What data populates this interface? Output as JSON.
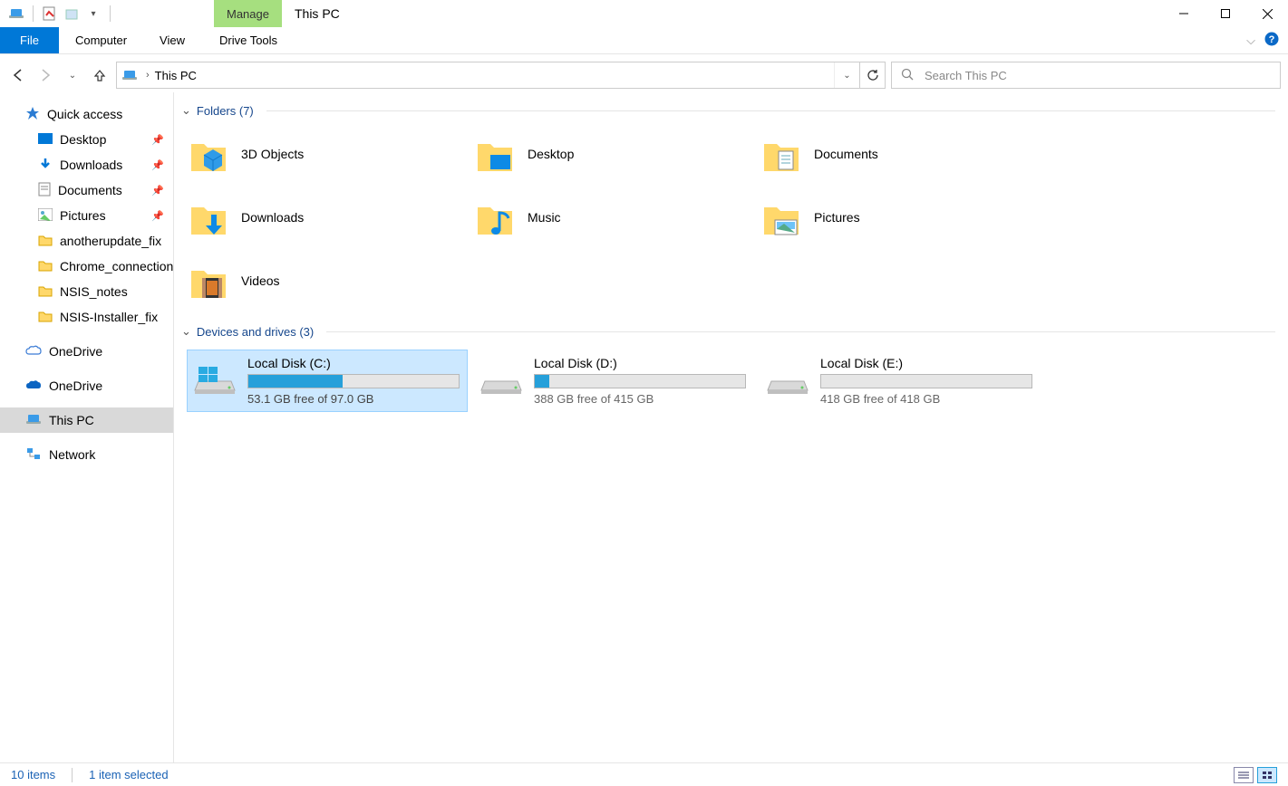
{
  "window": {
    "title": "This PC",
    "contextual_tab": "Manage"
  },
  "ribbon": {
    "file": "File",
    "computer": "Computer",
    "view": "View",
    "drive_tools": "Drive Tools"
  },
  "address": {
    "location": "This PC"
  },
  "search": {
    "placeholder": "Search This PC"
  },
  "sidebar": {
    "quick_access": "Quick access",
    "items": [
      {
        "label": "Desktop",
        "pinned": true
      },
      {
        "label": "Downloads",
        "pinned": true
      },
      {
        "label": "Documents",
        "pinned": true
      },
      {
        "label": "Pictures",
        "pinned": true
      },
      {
        "label": "anotherupdate_fix",
        "pinned": false
      },
      {
        "label": "Chrome_connection",
        "pinned": false
      },
      {
        "label": "NSIS_notes",
        "pinned": false
      },
      {
        "label": "NSIS-Installer_fix",
        "pinned": false
      }
    ],
    "onedrive1": "OneDrive",
    "onedrive2": "OneDrive",
    "this_pc": "This PC",
    "network": "Network"
  },
  "groups": {
    "folders_header": "Folders (7)",
    "drives_header": "Devices and drives (3)"
  },
  "folders": [
    {
      "label": "3D Objects"
    },
    {
      "label": "Desktop"
    },
    {
      "label": "Documents"
    },
    {
      "label": "Downloads"
    },
    {
      "label": "Music"
    },
    {
      "label": "Pictures"
    },
    {
      "label": "Videos"
    }
  ],
  "drives": [
    {
      "label": "Local Disk (C:)",
      "free_text": "53.1 GB free of 97.0 GB",
      "used_pct": 45,
      "selected": true,
      "os": true
    },
    {
      "label": "Local Disk (D:)",
      "free_text": "388 GB free of 415 GB",
      "used_pct": 7,
      "selected": false,
      "os": false
    },
    {
      "label": "Local Disk (E:)",
      "free_text": "418 GB free of 418 GB",
      "used_pct": 0,
      "selected": false,
      "os": false
    }
  ],
  "status": {
    "count": "10 items",
    "selection": "1 item selected"
  }
}
